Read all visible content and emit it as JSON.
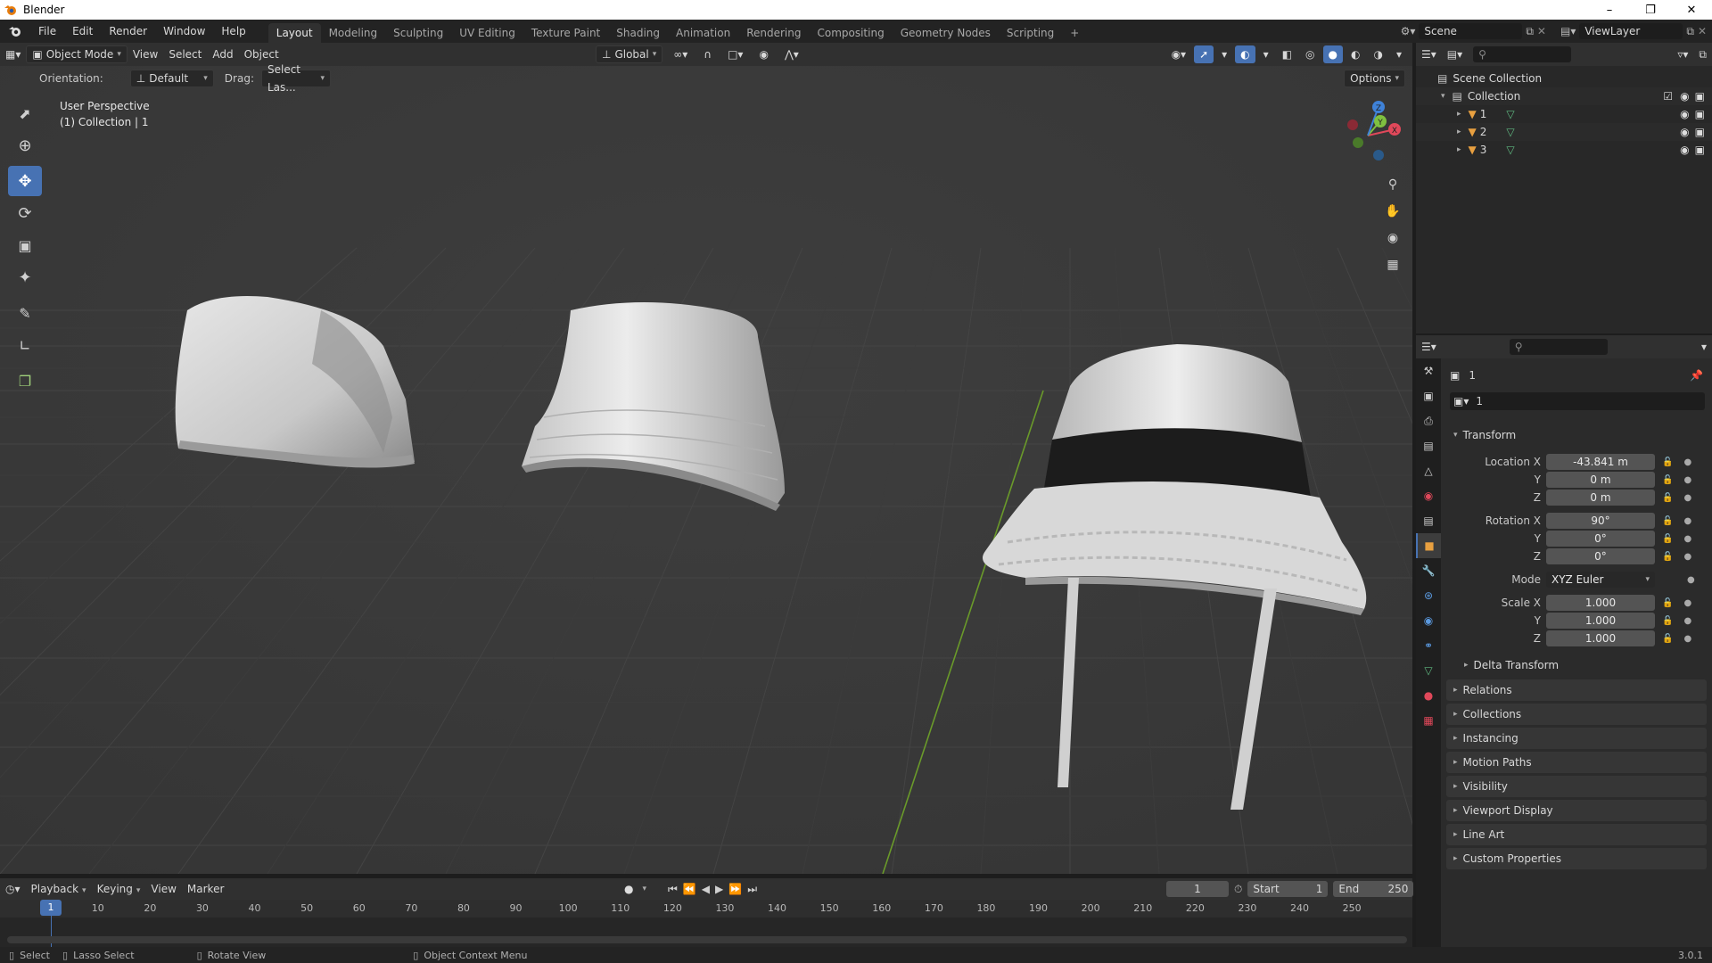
{
  "window": {
    "title": "Blender",
    "min_icon": "minimize-icon",
    "max_icon": "maximize-icon",
    "close_icon": "close-icon"
  },
  "menubar": {
    "menus": [
      "File",
      "Edit",
      "Render",
      "Window",
      "Help"
    ],
    "workspaces": [
      "Layout",
      "Modeling",
      "Sculpting",
      "UV Editing",
      "Texture Paint",
      "Shading",
      "Animation",
      "Rendering",
      "Compositing",
      "Geometry Nodes",
      "Scripting"
    ],
    "active_workspace": "Layout",
    "add_workspace": "+",
    "scene": "Scene",
    "view_layer": "ViewLayer"
  },
  "viewport_header": {
    "mode": "Object Mode",
    "menus": [
      "View",
      "Select",
      "Add",
      "Object"
    ],
    "transform_orientation": "Global",
    "options": "Options"
  },
  "tool_settings": {
    "orientation_label": "Orientation:",
    "orientation_value": "Default",
    "drag_label": "Drag:",
    "drag_value": "Select Las..."
  },
  "viewport": {
    "perspective": "User Perspective",
    "collection_info": "(1) Collection | 1",
    "gizmo_axes": [
      "X",
      "Y",
      "Z"
    ]
  },
  "timeline": {
    "menus": [
      "Playback",
      "Keying",
      "View",
      "Marker"
    ],
    "current_frame": "1",
    "start_label": "Start",
    "start": "1",
    "end_label": "End",
    "end": "250",
    "ruler": [
      "1",
      "10",
      "20",
      "30",
      "40",
      "50",
      "60",
      "70",
      "80",
      "90",
      "100",
      "110",
      "120",
      "130",
      "140",
      "150",
      "160",
      "170",
      "180",
      "190",
      "200",
      "210",
      "220",
      "230",
      "240",
      "250"
    ]
  },
  "statusbar": {
    "items": [
      "Select",
      "Lasso Select",
      "Rotate View",
      "Object Context Menu"
    ],
    "version": "3.0.1"
  },
  "outliner": {
    "scene_collection": "Scene Collection",
    "collection": "Collection",
    "objects": [
      "1",
      "2",
      "3"
    ]
  },
  "properties": {
    "object_name": "1",
    "datablock_name": "1",
    "transform": {
      "title": "Transform",
      "location": {
        "label_x": "Location X",
        "x": "-43.841 m",
        "y": "0 m",
        "z": "0 m"
      },
      "rotation": {
        "label_x": "Rotation X",
        "x": "90°",
        "y": "0°",
        "z": "0°"
      },
      "mode_label": "Mode",
      "mode": "XYZ Euler",
      "scale": {
        "label_x": "Scale X",
        "x": "1.000",
        "y": "1.000",
        "z": "1.000"
      },
      "axis_y": "Y",
      "axis_z": "Z",
      "delta": "Delta Transform"
    },
    "panels": [
      "Relations",
      "Collections",
      "Instancing",
      "Motion Paths",
      "Visibility",
      "Viewport Display",
      "Line Art",
      "Custom Properties"
    ]
  },
  "colors": {
    "accent": "#4772b3",
    "x_axis": "#e0485a",
    "y_axis": "#7fc040",
    "z_axis": "#3f82d8"
  }
}
